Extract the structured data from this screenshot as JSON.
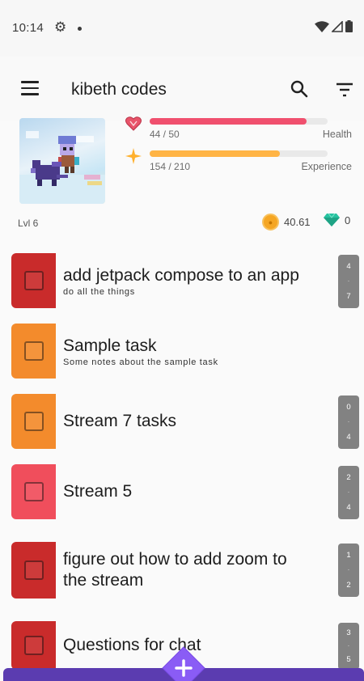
{
  "status_bar": {
    "time": "10:14"
  },
  "app_bar": {
    "title": "kibeth codes"
  },
  "stats": {
    "health": {
      "value_text": "44 / 50",
      "label": "Health",
      "fraction": 0.88,
      "color": "#f0506e"
    },
    "experience": {
      "value_text": "154 / 210",
      "label": "Experience",
      "fraction": 0.7333,
      "color": "#ffb445"
    },
    "level": "Lvl 6",
    "gold": "40.61",
    "gems": "0"
  },
  "tasks": [
    {
      "title": "add jetpack compose to an app",
      "notes": "do all the things",
      "color": "#c92b2b",
      "counter_top": "4",
      "counter_bottom": "7"
    },
    {
      "title": "Sample task",
      "notes": "Some notes about the sample task",
      "color": "#f38b2c",
      "counter_top": "",
      "counter_bottom": ""
    },
    {
      "title": "Stream 7 tasks",
      "notes": "",
      "color": "#f38b2c",
      "counter_top": "0",
      "counter_bottom": "4"
    },
    {
      "title": "Stream 5",
      "notes": "",
      "color": "#f04e5c",
      "counter_top": "2",
      "counter_bottom": "4"
    },
    {
      "title": "figure out how to add zoom to the stream",
      "notes": "",
      "color": "#c92b2b",
      "counter_top": "1",
      "counter_bottom": "2"
    },
    {
      "title": "Questions for chat",
      "notes": "",
      "color": "#c92b2b",
      "counter_top": "3",
      "counter_bottom": "5"
    }
  ],
  "colors": {
    "accent": "#5b3cb0",
    "fab": "#8a5cf5"
  },
  "icons": [
    "settings-icon",
    "wifi-icon",
    "signal-icon",
    "battery-icon",
    "menu-icon",
    "search-icon",
    "filter-icon",
    "heart-icon",
    "star-icon",
    "gold-icon",
    "gem-icon",
    "add-icon"
  ]
}
